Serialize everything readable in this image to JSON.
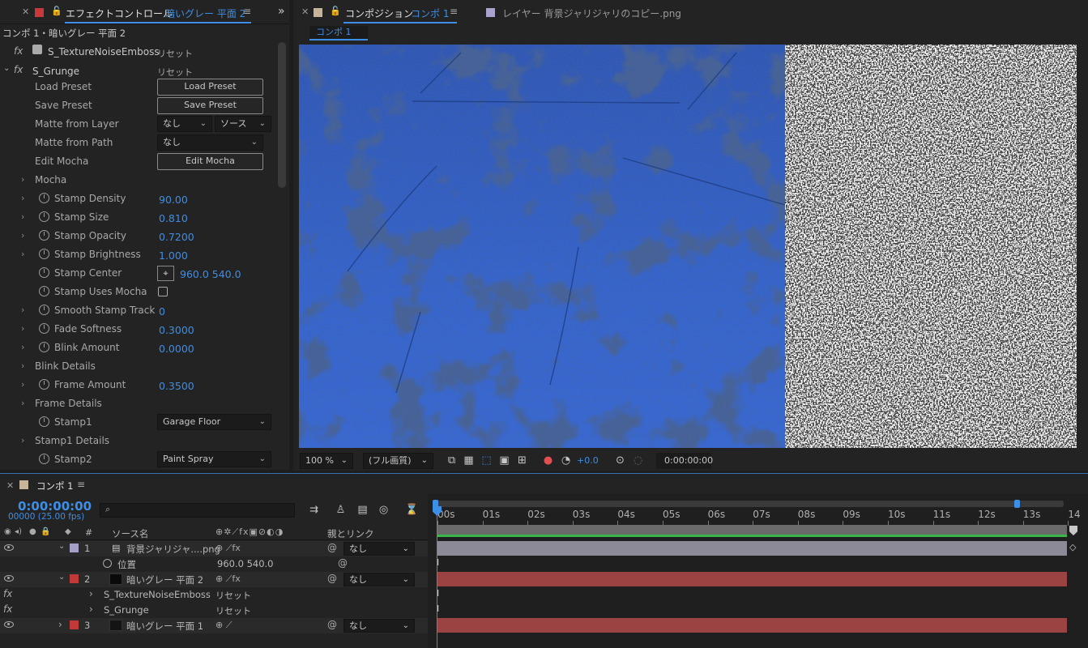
{
  "effect_panel": {
    "tab_title": "エフェクトコントロール",
    "tab_layer": "暗いグレー 平面 2",
    "breadcrumb": "コンポ 1・暗いグレー 平面 2",
    "effect1": {
      "name": "S_TextureNoiseEmboss",
      "reset": "リセット"
    },
    "effect2": {
      "name": "S_Grunge",
      "reset": "リセット"
    },
    "load_preset": {
      "label": "Load Preset",
      "button": "Load Preset"
    },
    "save_preset": {
      "label": "Save Preset",
      "button": "Save Preset"
    },
    "matte_layer": {
      "label": "Matte from Layer",
      "value1": "なし",
      "value2": "ソース"
    },
    "matte_path": {
      "label": "Matte from Path",
      "value": "なし"
    },
    "edit_mocha": {
      "label": "Edit Mocha",
      "button": "Edit Mocha"
    },
    "mocha": "Mocha",
    "props": [
      {
        "label": "Stamp Density",
        "value": "90.00"
      },
      {
        "label": "Stamp Size",
        "value": "0.810"
      },
      {
        "label": "Stamp Opacity",
        "value": "0.7200"
      },
      {
        "label": "Stamp Brightness",
        "value": "1.000"
      }
    ],
    "stamp_center": {
      "label": "Stamp Center",
      "value": "960.0  540.0"
    },
    "stamp_uses_mocha": {
      "label": "Stamp Uses Mocha",
      "checked": false
    },
    "smooth_track": {
      "label": "Smooth Stamp Track",
      "value": "0"
    },
    "fade_softness": {
      "label": "Fade Softness",
      "value": "0.3000"
    },
    "blink_amount": {
      "label": "Blink Amount",
      "value": "0.0000"
    },
    "blink_details": "Blink Details",
    "frame_amount": {
      "label": "Frame Amount",
      "value": "0.3500"
    },
    "frame_details": "Frame Details",
    "stamp1": {
      "label": "Stamp1",
      "value": "Garage Floor"
    },
    "stamp1_details": "Stamp1 Details",
    "stamp2": {
      "label": "Stamp2",
      "value": "Paint Spray"
    }
  },
  "comp_panel": {
    "tab_title": "コンポジション",
    "tab_comp": "コンポ 1",
    "layer_tab": "レイヤー 背景ジャリジャリのコピー.png",
    "sub_tab": "コンポ 1",
    "zoom": "100 %",
    "quality": "(フル画質)",
    "exposure": "+0.0",
    "timecode": "0:00:00:00"
  },
  "timeline": {
    "tab": "コンポ 1",
    "timecode": "0:00:00:00",
    "frames": "00000 (25.00 fps)",
    "search_placeholder": "",
    "col_num": "#",
    "col_source": "ソース名",
    "col_parent": "親とリンク",
    "ruler": [
      "00s",
      "01s",
      "02s",
      "03s",
      "04s",
      "05s",
      "06s",
      "07s",
      "08s",
      "09s",
      "10s",
      "11s",
      "12s",
      "13s",
      "14"
    ],
    "layers": [
      {
        "num": "1",
        "name": "背景ジャリジャ....png",
        "parent": "なし",
        "color": "#a5a0c8",
        "bar": "#8c8a96"
      },
      {
        "num": "2",
        "name": "暗いグレー 平面 2",
        "parent": "なし",
        "color": "#c03a3a",
        "bar": "#9b4343"
      },
      {
        "num": "3",
        "name": "暗いグレー 平面 1",
        "parent": "なし",
        "color": "#c03a3a",
        "bar": "#9b4343"
      }
    ],
    "position": {
      "label": "位置",
      "value": "960.0  540.0"
    },
    "effects": [
      {
        "name": "S_TextureNoiseEmboss",
        "reset": "リセット"
      },
      {
        "name": "S_Grunge",
        "reset": "リセット"
      }
    ]
  },
  "colors": {
    "accent": "#3d8ee6",
    "panel": "#232323",
    "bg": "#1d1d1d",
    "blue_solid": "#2f5fd0"
  }
}
